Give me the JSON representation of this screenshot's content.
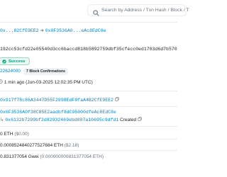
{
  "search": {
    "placeholder": "Search by Address / Txn Hash / Block / T"
  },
  "header": {
    "from_short": "0x...82CfE9EE2",
    "to_short": "0x0F3536A0...eAc8EdC8e"
  },
  "tx": {
    "hash": "192cc53cfd22e05540d3cc6baccd818b5892759dbf35cfecc0ed1703d6d7b570",
    "status": "Success",
    "block": "22624000",
    "confirmations": "7 Block Confirmations",
    "timestamp": "1 min ago (Jun-03-2025 12:02:35 PM UTC)",
    "from": "0x917f78c86A3447D55F2898EdF9faA4B2CfE9EE2",
    "interacted_with": "0x0F3536A0f38C85E2aadbf8dC95000dfeAc8EdC8e",
    "internal_hash": "0x6132b7299bf2d82932469ebd087a10695c9dfd1",
    "internal_status": "Created",
    "value": "0 ETH",
    "value_usd": "($0.00)",
    "fee": "0.0008524840277527684 ETH",
    "fee_usd": "($2.18)",
    "gas_price": "0.831377054 Gwei",
    "gas_price_eth": "(0.000000000831377054 ETH)"
  },
  "colors": {
    "link": "#0784c3",
    "success": "#00a186",
    "muted": "#6c757d"
  }
}
